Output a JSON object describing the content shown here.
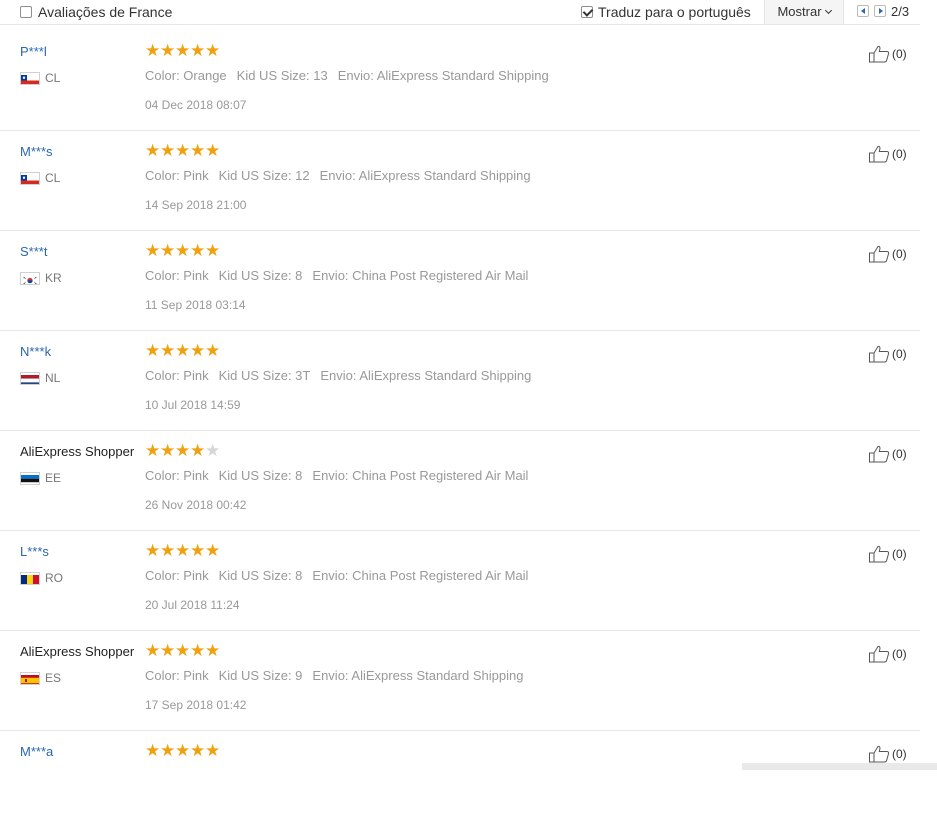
{
  "toolbar": {
    "france_label": "Avaliações de France",
    "translate_label": "Traduz para o português",
    "show_label": "Mostrar",
    "page_indicator": "2/3"
  },
  "colors": {
    "link": "#2a67b1",
    "star": "#f0a10f",
    "star_empty": "#d6d6d6",
    "meta_text": "#999999"
  },
  "reviews": [
    {
      "user": "P***l",
      "country": "CL",
      "flag": "flag-cl-icon",
      "rating": 5,
      "attrs": [
        "Color: Orange",
        "Kid US Size: 13",
        "Envio: AliExpress Standard Shipping"
      ],
      "date": "04 Dec 2018 08:07",
      "helpful": "(0)"
    },
    {
      "user": "M***s",
      "country": "CL",
      "flag": "flag-cl-icon",
      "rating": 5,
      "attrs": [
        "Color: Pink",
        "Kid US Size: 12",
        "Envio: AliExpress Standard Shipping"
      ],
      "date": "14 Sep 2018 21:00",
      "helpful": "(0)"
    },
    {
      "user": "S***t",
      "country": "KR",
      "flag": "flag-kr-icon",
      "rating": 5,
      "attrs": [
        "Color: Pink",
        "Kid US Size: 8",
        "Envio: China Post Registered Air Mail"
      ],
      "date": "11 Sep 2018 03:14",
      "helpful": "(0)"
    },
    {
      "user": "N***k",
      "country": "NL",
      "flag": "flag-nl-icon",
      "rating": 5,
      "attrs": [
        "Color: Pink",
        "Kid US Size: 3T",
        "Envio: AliExpress Standard Shipping"
      ],
      "date": "10 Jul 2018 14:59",
      "helpful": "(0)"
    },
    {
      "user": "AliExpress Shopper",
      "country": "EE",
      "flag": "flag-ee-icon",
      "rating": 4,
      "attrs": [
        "Color: Pink",
        "Kid US Size: 8",
        "Envio: China Post Registered Air Mail"
      ],
      "date": "26 Nov 2018 00:42",
      "helpful": "(0)"
    },
    {
      "user": "L***s",
      "country": "RO",
      "flag": "flag-ro-icon",
      "rating": 5,
      "attrs": [
        "Color: Pink",
        "Kid US Size: 8",
        "Envio: China Post Registered Air Mail"
      ],
      "date": "20 Jul 2018 11:24",
      "helpful": "(0)"
    },
    {
      "user": "AliExpress Shopper",
      "country": "ES",
      "flag": "flag-es-icon",
      "rating": 5,
      "attrs": [
        "Color: Pink",
        "Kid US Size: 9",
        "Envio: AliExpress Standard Shipping"
      ],
      "date": "17 Sep 2018 01:42",
      "helpful": "(0)"
    },
    {
      "user": "M***a",
      "country": "",
      "flag": "",
      "rating": 5,
      "attrs": [],
      "date": "",
      "helpful": "(0)"
    }
  ]
}
